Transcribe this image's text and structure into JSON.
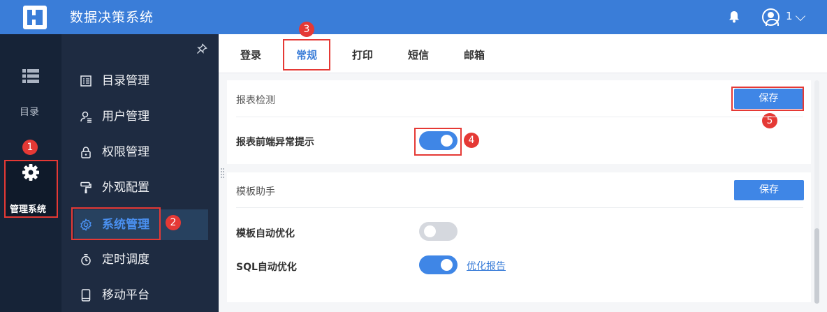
{
  "header": {
    "app_title": "数据决策系统",
    "user_name": "1",
    "icons": [
      "app-logo-icon",
      "bell-icon",
      "user-avatar-icon",
      "chevron-down-icon"
    ]
  },
  "left_nav": {
    "catalog_label": "目录",
    "admin_label": "管理系统",
    "catalog_icon": "list-icon",
    "admin_icon": "gear-icon"
  },
  "menu": {
    "items": [
      {
        "label": "目录管理",
        "icon": "catalog-manage-icon"
      },
      {
        "label": "用户管理",
        "icon": "user-manage-icon"
      },
      {
        "label": "权限管理",
        "icon": "lock-icon"
      },
      {
        "label": "外观配置",
        "icon": "paint-roller-icon"
      },
      {
        "label": "系统管理",
        "icon": "settings-icon",
        "active": true
      },
      {
        "label": "定时调度",
        "icon": "timer-icon"
      },
      {
        "label": "移动平台",
        "icon": "mobile-icon"
      }
    ]
  },
  "tabs": [
    "登录",
    "常规",
    "打印",
    "短信",
    "邮箱"
  ],
  "active_tab": "常规",
  "report_check": {
    "title": "报表检测",
    "save_label": "保存",
    "front_alert_label": "报表前端异常提示",
    "front_alert_enabled": true
  },
  "template_helper": {
    "title": "模板助手",
    "save_label": "保存",
    "auto_optimize_label": "模板自动优化",
    "auto_optimize_enabled": false,
    "sql_optimize_label": "SQL自动优化",
    "sql_optimize_enabled": true,
    "report_link": "优化报告"
  },
  "annotations": [
    "1",
    "2",
    "3",
    "4",
    "5"
  ],
  "colors": {
    "header": "#3a7dd8",
    "accent": "#3f86e6",
    "highlight": "#e53935",
    "nav_dark": "#162337",
    "menu_bg": "#1e2b41"
  }
}
